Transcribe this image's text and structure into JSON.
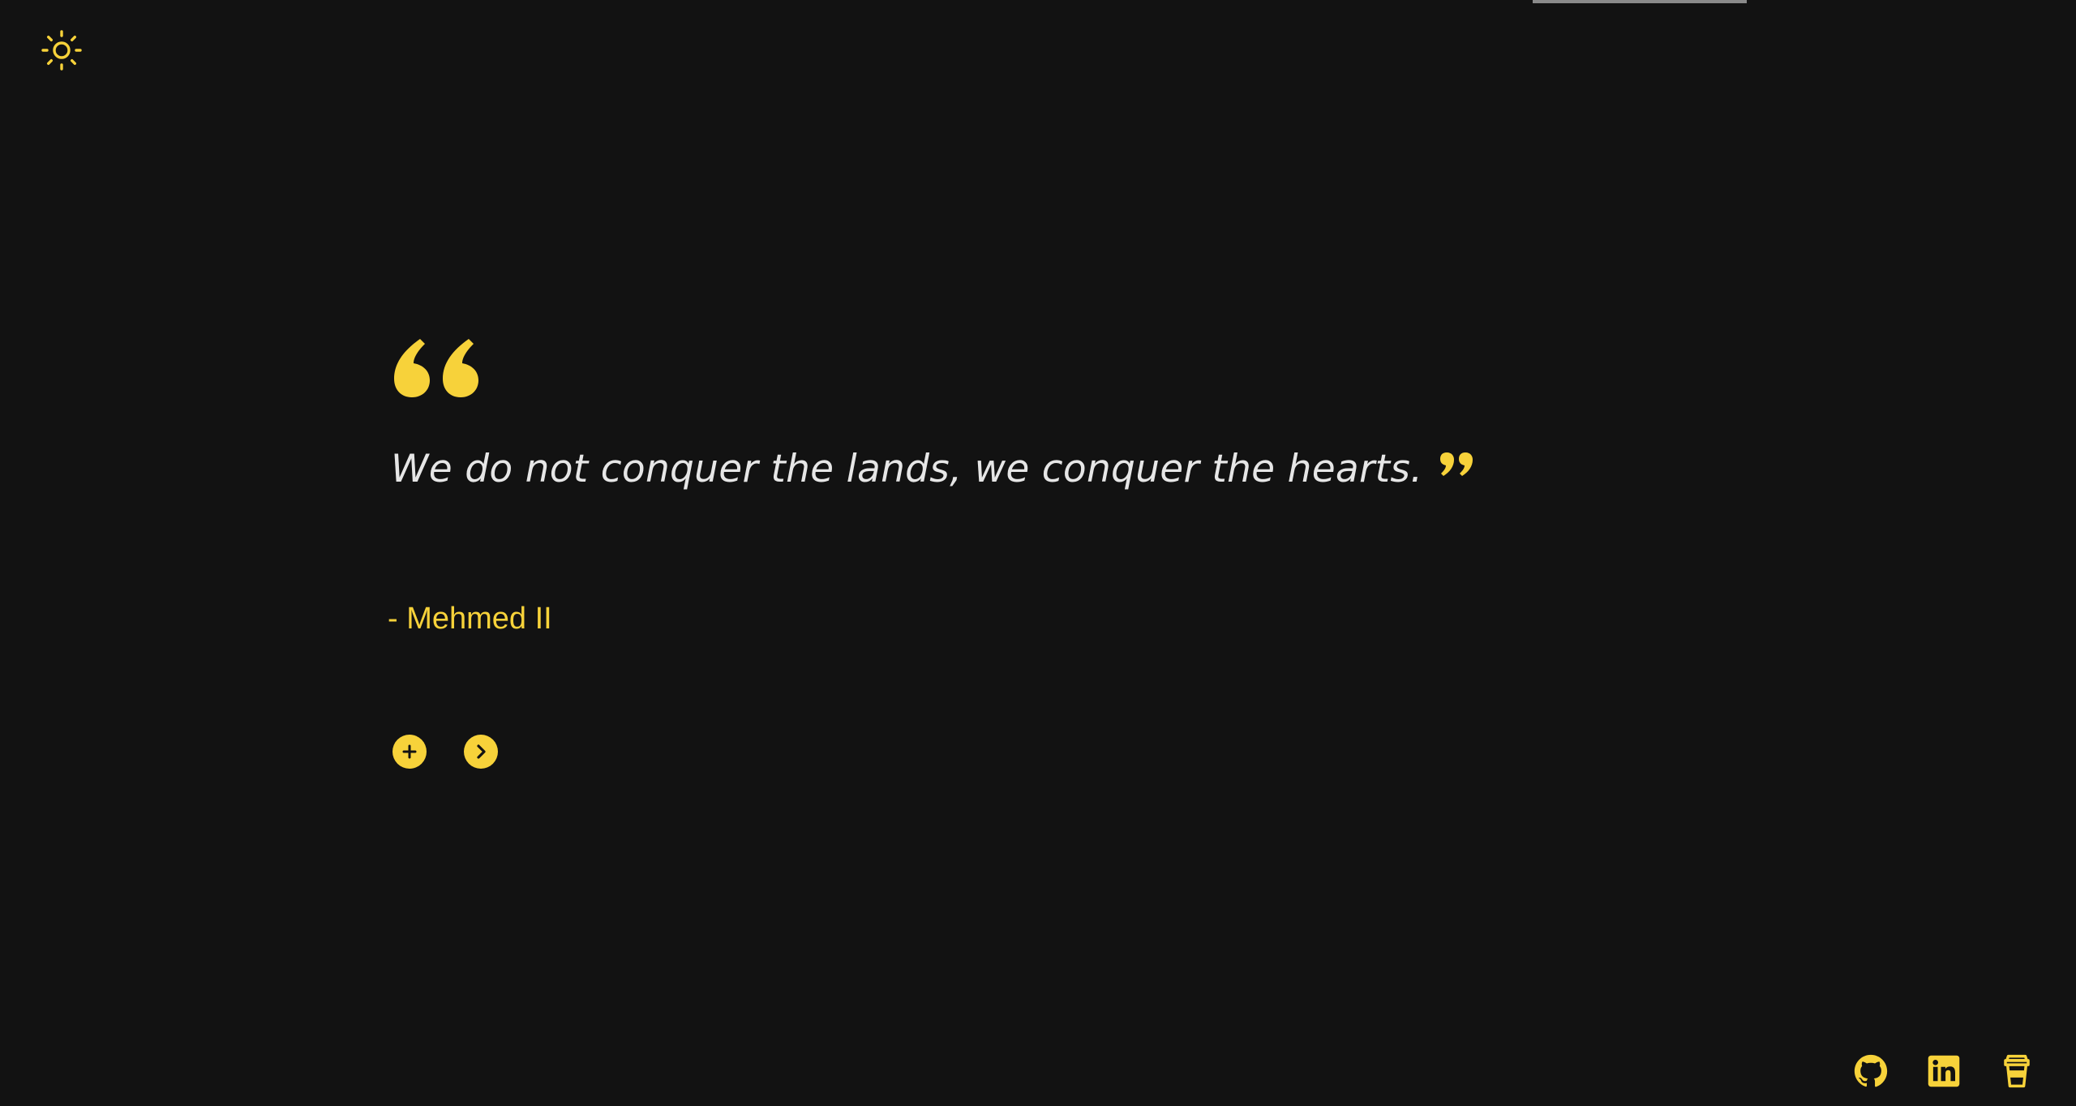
{
  "theme": {
    "background": "#121212",
    "accent": "#f7d23a",
    "text": "#e6e6e6",
    "toggle_icon": "sun-icon"
  },
  "quote": {
    "text": "We do not conquer the lands, we conquer the hearts.",
    "author": "- Mehmed II",
    "open_icon": "open-quote-icon",
    "close_icon": "close-quote-icon"
  },
  "actions": {
    "add_icon": "plus-circle-icon",
    "next_icon": "chevron-right-circle-icon"
  },
  "social": {
    "items": [
      {
        "name": "github",
        "icon": "github-icon"
      },
      {
        "name": "linkedin",
        "icon": "linkedin-icon"
      },
      {
        "name": "coffee",
        "icon": "coffee-cup-icon"
      }
    ]
  }
}
